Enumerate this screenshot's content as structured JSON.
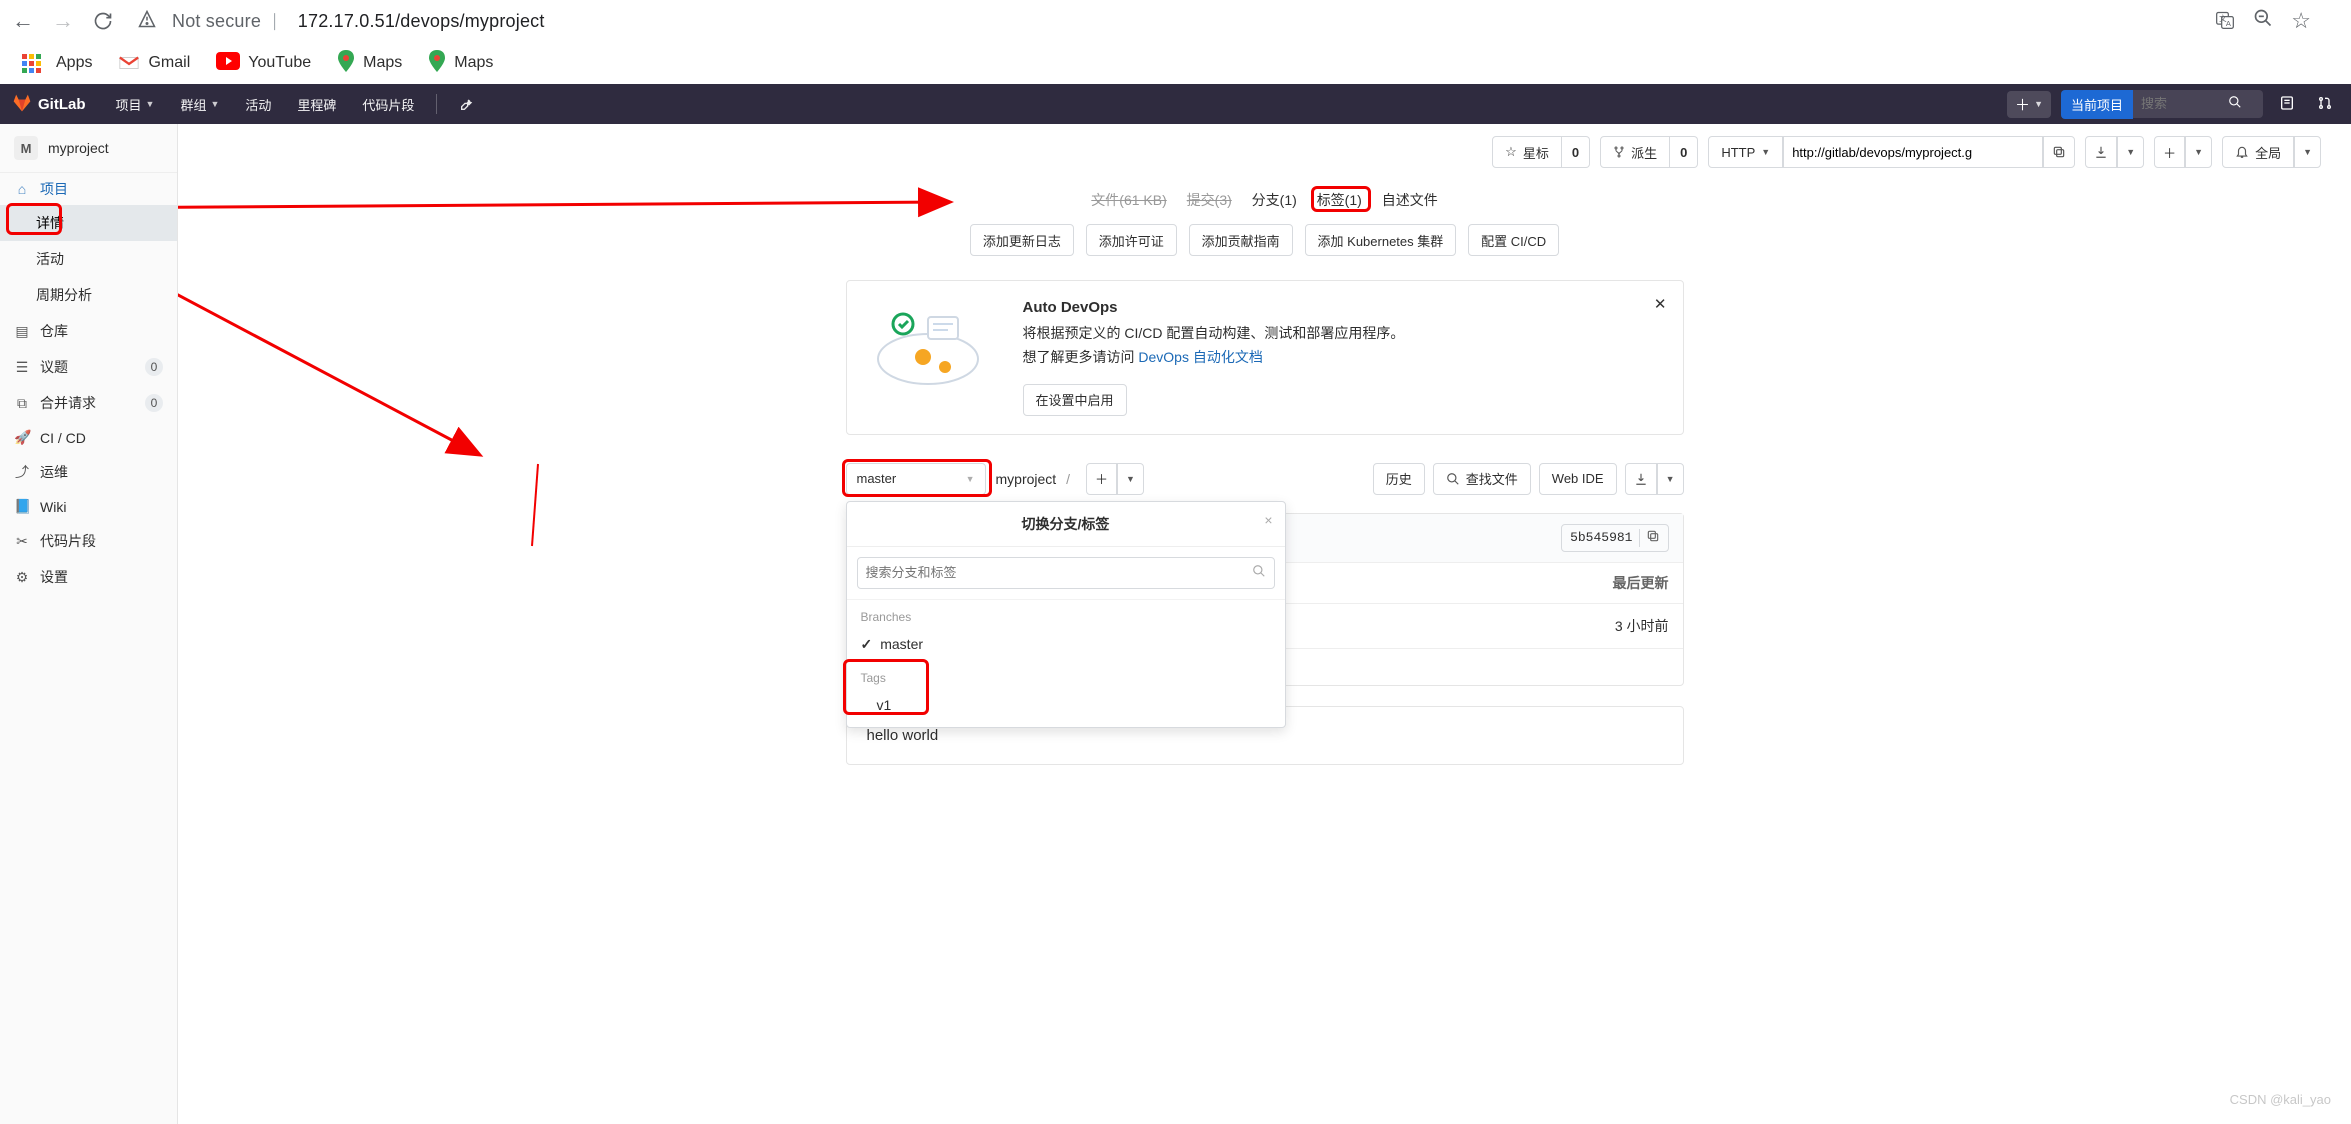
{
  "browser": {
    "insecure_label": "Not secure",
    "url": "172.17.0.51/devops/myproject",
    "bookmarks": {
      "apps": "Apps",
      "gmail": "Gmail",
      "youtube": "YouTube",
      "maps1": "Maps",
      "maps2": "Maps"
    }
  },
  "nav": {
    "brand": "GitLab",
    "project_menu": "项目",
    "group_menu": "群组",
    "activity": "活动",
    "milestones": "里程碑",
    "snippets": "代码片段",
    "scope_button": "当前项目",
    "search_placeholder": "搜索"
  },
  "sidebar": {
    "project_initial": "M",
    "project_name": "myproject",
    "section_project": "项目",
    "details": "详情",
    "activity": "活动",
    "cycle": "周期分析",
    "repo": "仓库",
    "issues": "议题",
    "issues_count": "0",
    "mr": "合并请求",
    "mr_count": "0",
    "cicd": "CI / CD",
    "ops": "运维",
    "wiki": "Wiki",
    "snippets": "代码片段",
    "settings": "设置"
  },
  "project_bar": {
    "star": "星标",
    "star_count": "0",
    "fork": "派生",
    "fork_count": "0",
    "protocol": "HTTP",
    "clone_url": "http://gitlab/devops/myproject.g",
    "notif": "全局"
  },
  "stats": {
    "files": "文件(61 KB)",
    "commits": "提交(3)",
    "branches": "分支(1)",
    "tags": "标签(1)",
    "readme": "自述文件"
  },
  "chips": {
    "a": "添加更新日志",
    "b": "添加许可证",
    "c": "添加贡献指南",
    "d": "添加 Kubernetes 集群",
    "e": "配置 CI/CD"
  },
  "autodev": {
    "title": "Auto DevOps",
    "line1": "将根据预定义的 CI/CD 配置自动构建、测试和部署应用程序。",
    "line2a": "想了解更多请访问",
    "line2b": "DevOps 自动化文档",
    "enable": "在设置中启用"
  },
  "tree": {
    "branch": "master",
    "crumb_root": "myproject",
    "history": "历史",
    "find": "查找文件",
    "webide": "Web IDE",
    "commit_hash": "5b545981",
    "col_updated": "最后更新",
    "row1_time": "3 小时前"
  },
  "dropdown": {
    "title": "切换分支/标签",
    "search_ph": "搜索分支和标签",
    "branches_label": "Branches",
    "tags_label": "Tags",
    "branch_master": "master",
    "tag_v1": "v1"
  },
  "file_content": "hello world",
  "watermark": "CSDN @kali_yao"
}
